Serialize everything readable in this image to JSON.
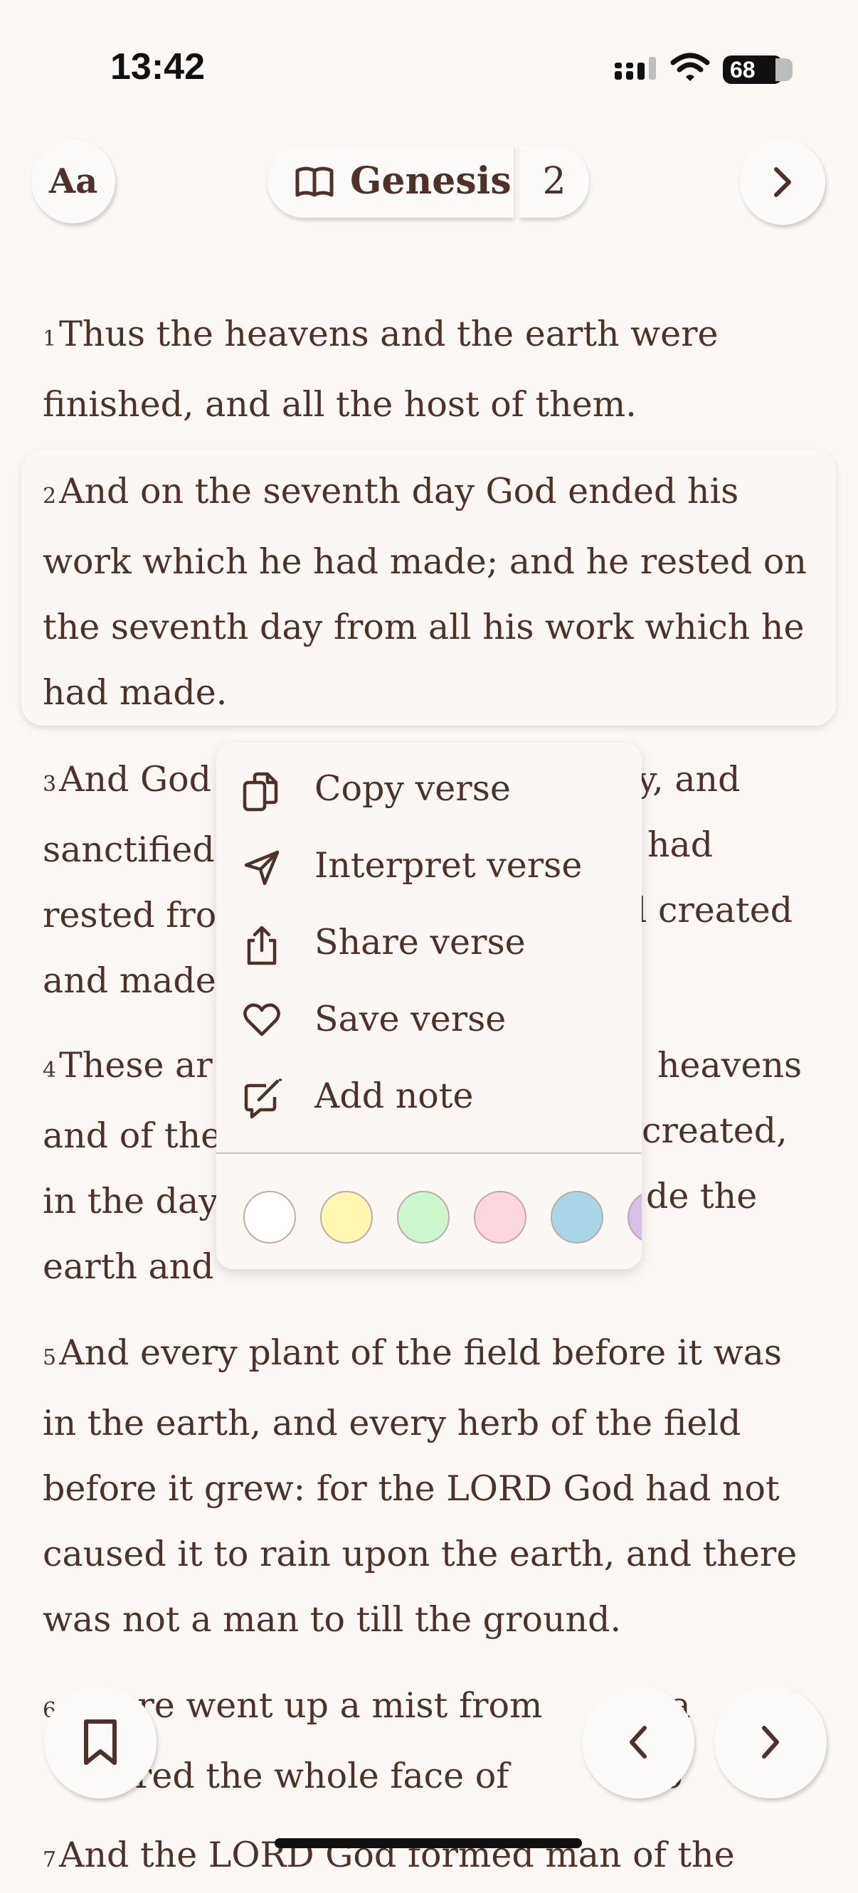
{
  "status_bar": {
    "time": "13:42",
    "battery": "68"
  },
  "header": {
    "font_button": "Aa",
    "book": "Genesis",
    "chapter": "2"
  },
  "verses": [
    {
      "n": "1",
      "lines": [
        "Thus the heavens and the earth were",
        "finished, and all the host of them."
      ]
    },
    {
      "n": "2",
      "lines": [
        "And on the seventh day God ended his",
        "work which he had made; and he rested on",
        "the seventh day from all his work which he",
        "had made."
      ]
    },
    {
      "n": "3",
      "lines": [
        "And God",
        "y, and",
        "sanctified",
        "had",
        "rested fro",
        "d created",
        "and made"
      ]
    },
    {
      "n": "4",
      "lines": [
        "These ar",
        "heavens",
        "and of the",
        "created,",
        "in the day",
        "de the",
        "earth and"
      ]
    },
    {
      "n": "5",
      "lines": [
        "And every plant of the field before it was",
        "in the earth, and every herb of the field",
        "before it grew: for the LORD God had not",
        "caused it to rain upon the earth, and there",
        "was not a man to till the ground."
      ]
    },
    {
      "n": "6",
      "lines": [
        "there went up a mist from",
        "ea",
        "atered the whole face of",
        "gro"
      ]
    },
    {
      "n": "7",
      "lines": [
        "And the LORD God formed man of the"
      ]
    }
  ],
  "context_menu": {
    "items": [
      {
        "label": "Copy verse",
        "icon": "copy-icon"
      },
      {
        "label": "Interpret verse",
        "icon": "send-icon"
      },
      {
        "label": "Share verse",
        "icon": "share-icon"
      },
      {
        "label": "Save verse",
        "icon": "heart-icon"
      },
      {
        "label": "Add note",
        "icon": "note-icon"
      }
    ],
    "highlight_colors": [
      "#ffffff",
      "#fff7b0",
      "#cdf7cf",
      "#fdd6e0",
      "#a9d6e6",
      "#d8bfe6"
    ]
  }
}
